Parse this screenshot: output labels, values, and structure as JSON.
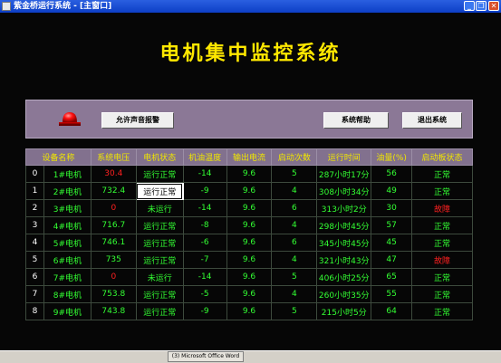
{
  "window": {
    "title": "紫金桥运行系统 - [主窗口]",
    "minimize_glyph": "_",
    "restore_glyph": "❐",
    "close_glyph": "✕"
  },
  "app": {
    "heading": "电机集中监控系统"
  },
  "toolbar": {
    "alarm_icon": "alarm-light",
    "sound_alarm_button": "允许声音报警",
    "help_button": "系统帮助",
    "exit_button": "退出系统"
  },
  "table": {
    "columns": [
      "设备名称",
      "系统电压",
      "电机状态",
      "机油温度",
      "输出电流",
      "启动次数",
      "运行时间",
      "油量(%)",
      "启动板状态"
    ],
    "rows": [
      [
        "0",
        "1#电机",
        "30.4",
        "运行正常",
        "-14",
        "9.6",
        "5",
        "287小时17分",
        "56",
        "正常"
      ],
      [
        "1",
        "2#电机",
        "732.4",
        "运行正常",
        "-9",
        "9.6",
        "4",
        "308小时34分",
        "49",
        "正常"
      ],
      [
        "2",
        "3#电机",
        "0",
        "未运行",
        "-14",
        "9.6",
        "6",
        "313小时2分",
        "30",
        "故障"
      ],
      [
        "3",
        "4#电机",
        "716.7",
        "运行正常",
        "-8",
        "9.6",
        "4",
        "298小时45分",
        "57",
        "正常"
      ],
      [
        "4",
        "5#电机",
        "746.1",
        "运行正常",
        "-6",
        "9.6",
        "6",
        "345小时45分",
        "45",
        "正常"
      ],
      [
        "5",
        "6#电机",
        "735",
        "运行正常",
        "-7",
        "9.6",
        "4",
        "321小时43分",
        "47",
        "故障"
      ],
      [
        "6",
        "7#电机",
        "0",
        "未运行",
        "-14",
        "9.6",
        "5",
        "406小时25分",
        "65",
        "正常"
      ],
      [
        "7",
        "8#电机",
        "753.8",
        "运行正常",
        "-5",
        "9.6",
        "4",
        "260小时35分",
        "55",
        "正常"
      ],
      [
        "8",
        "9#电机",
        "743.8",
        "运行正常",
        "-9",
        "9.6",
        "5",
        "215小时5分",
        "64",
        "正常"
      ]
    ]
  },
  "taskbar": {
    "item_label": "(3) Microsoft Office Word"
  },
  "colors": {
    "title_text": "#ffe800",
    "header_bg": "#82718e",
    "normal_value": "#33ff33",
    "alarm_value": "#ff2020",
    "toolbar_bg": "#8b7896"
  }
}
